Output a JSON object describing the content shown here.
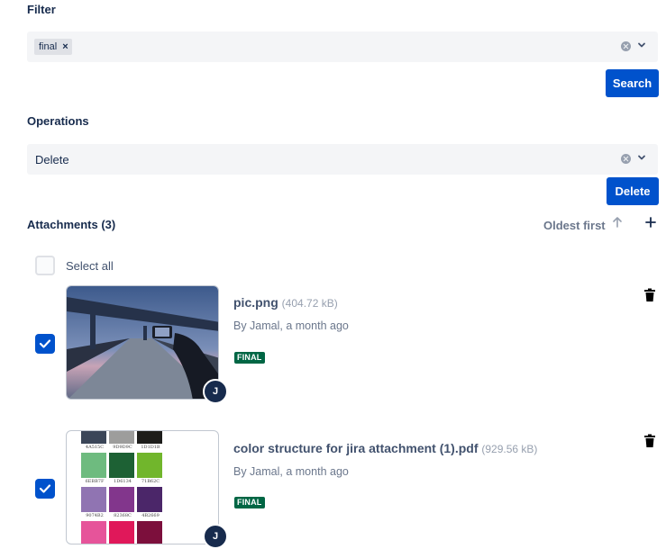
{
  "filter": {
    "label": "Filter",
    "chip": "final",
    "chip_remove": "×",
    "search_button": "Search"
  },
  "operations": {
    "label": "Operations",
    "selected": "Delete",
    "delete_button": "Delete"
  },
  "attachments": {
    "header": "Attachments (3)",
    "sort_label": "Oldest first",
    "select_all": "Select all",
    "items": [
      {
        "name": "pic.png",
        "size": "(404.72 kB)",
        "meta": "By Jamal, a month ago",
        "badge": "FINAL",
        "avatar": "J",
        "checked": true
      },
      {
        "name": "color structure for jira attachment (1).pdf",
        "size": "(929.56 kB)",
        "meta": "By Jamal, a month ago",
        "badge": "FINAL",
        "avatar": "J",
        "checked": true,
        "swatches": [
          {
            "color": "#3b4658",
            "code": "4A515C"
          },
          {
            "color": "#9d9d9c",
            "code": "9D9D9C"
          },
          {
            "color": "#1d1d1b",
            "code": "1D1D1B"
          },
          {
            "color": "#6ebb7f",
            "code": "6EBB7F"
          },
          {
            "color": "#1d6134",
            "code": "1D6134"
          },
          {
            "color": "#71b62c",
            "code": "71B62C"
          },
          {
            "color": "#9074b2",
            "code": "9074B2"
          },
          {
            "color": "#82368c",
            "code": "82368C"
          },
          {
            "color": "#4b2669",
            "code": "4B2669"
          },
          {
            "color": "#e6549a",
            "code": ""
          },
          {
            "color": "#e0185a",
            "code": ""
          },
          {
            "color": "#7c0f3c",
            "code": ""
          }
        ]
      }
    ]
  },
  "colors": {
    "primary": "#0052cc",
    "text": "#172b4d",
    "subtle": "#6b778c",
    "badge": "#006644",
    "field_bg": "#f4f5f7"
  }
}
